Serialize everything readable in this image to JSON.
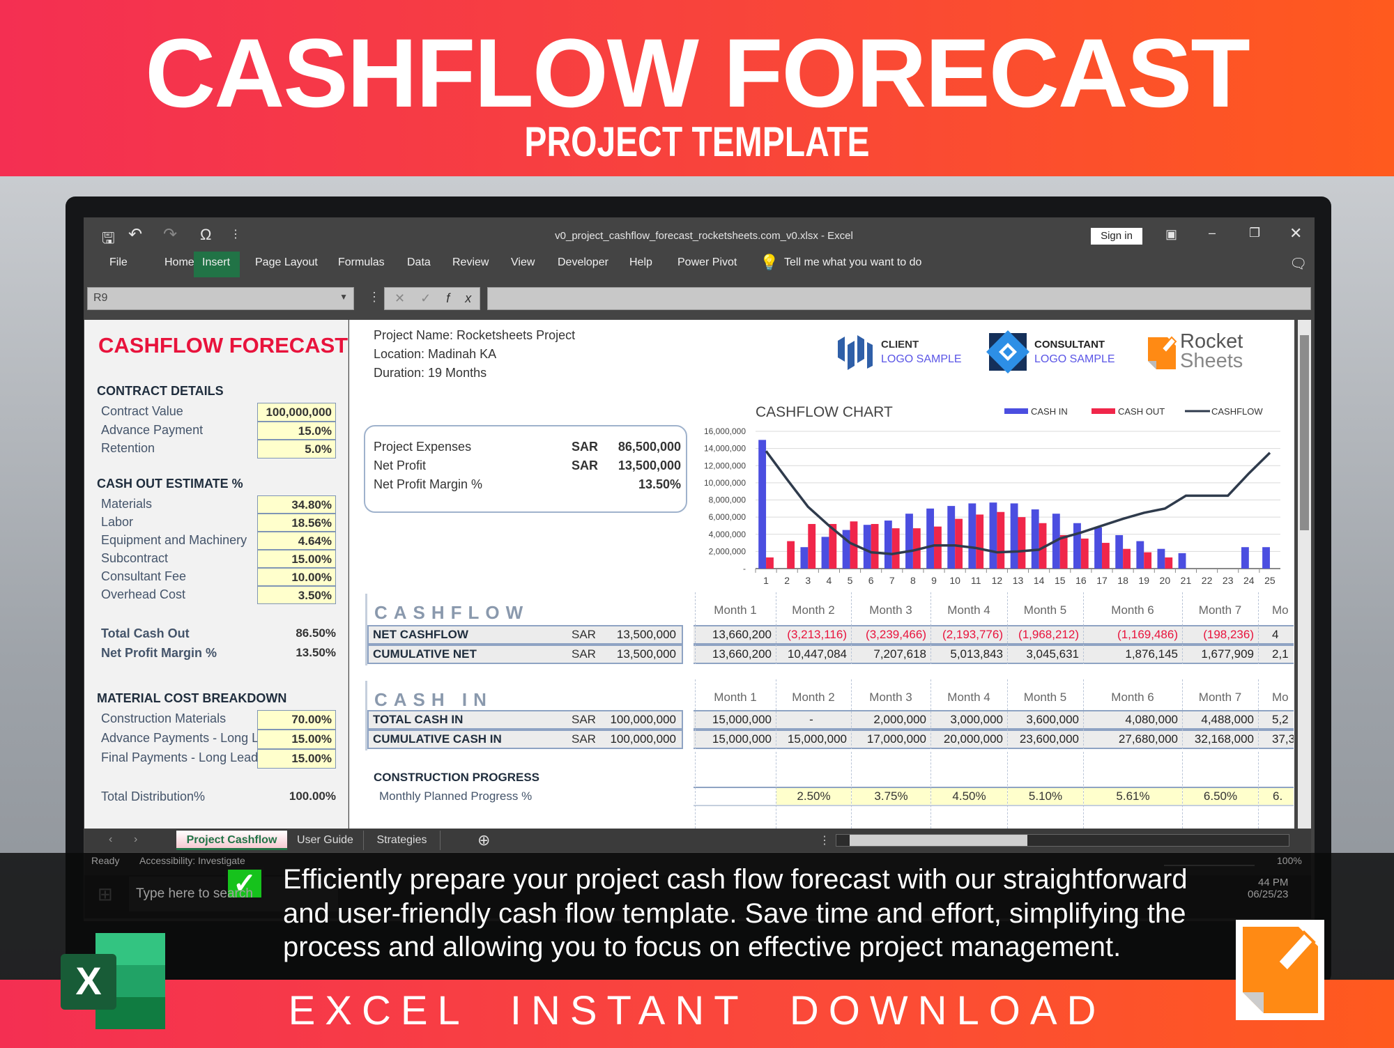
{
  "banner": {
    "title": "CASHFLOW FORECAST",
    "subtitle": "PROJECT TEMPLATE"
  },
  "excel": {
    "file_title": "v0_project_cashflow_forecast_rocketsheets.com_v0.xlsx  -  Excel",
    "sign_in": "Sign in",
    "tabs": [
      "File",
      "Home",
      "Insert",
      "Page Layout",
      "Formulas",
      "Data",
      "Review",
      "View",
      "Developer",
      "Help",
      "Power Pivot"
    ],
    "active_tab": "Insert",
    "tell_me": "Tell me what you want to do",
    "name_box": "R9",
    "formula_value": "",
    "sheet_tabs": [
      "Project Cashflow",
      "User Guide",
      "Strategies"
    ],
    "active_sheet": "Project Cashflow",
    "status": {
      "ready": "Ready",
      "accessibility": "Accessibility: Investigate",
      "zoom": "100%"
    },
    "taskbar": {
      "search_placeholder": "Type here to search",
      "time": "44 PM",
      "date": "06/25/23"
    },
    "colors": {
      "accent_green": "#217346",
      "title_red": "#e8133c"
    }
  },
  "left": {
    "title": "CASHFLOW FORECAST",
    "contract": {
      "heading": "CONTRACT DETAILS",
      "rows": [
        [
          "Contract Value",
          "100,000,000"
        ],
        [
          "Advance Payment",
          "15.0%"
        ],
        [
          "Retention",
          "5.0%"
        ]
      ]
    },
    "cash_out": {
      "heading": "CASH OUT ESTIMATE %",
      "rows": [
        [
          "Materials",
          "34.80%"
        ],
        [
          "Labor",
          "18.56%"
        ],
        [
          "Equipment and Machinery",
          "4.64%"
        ],
        [
          "Subcontract",
          "15.00%"
        ],
        [
          "Consultant Fee",
          "10.00%"
        ],
        [
          "Overhead Cost",
          "3.50%"
        ]
      ]
    },
    "totals": [
      [
        "Total Cash Out",
        "86.50%"
      ],
      [
        "Net Profit Margin %",
        "13.50%"
      ]
    ],
    "material": {
      "heading": "MATERIAL COST BREAKDOWN",
      "rows": [
        [
          "Construction Materials",
          "70.00%"
        ],
        [
          "Advance Payments - Long Lead",
          "15.00%"
        ],
        [
          "Final Payments - Long Lead",
          "15.00%"
        ]
      ]
    },
    "total_distribution": [
      "Total Distribution%",
      "100.00%"
    ]
  },
  "project": {
    "name": "Project Name:  Rocketsheets Project",
    "location": "Location: Madinah KA",
    "duration": "Duration: 19 Months"
  },
  "summary": {
    "rows": [
      [
        "Project Expenses",
        "SAR",
        "86,500,000"
      ],
      [
        "Net Profit",
        "SAR",
        "13,500,000"
      ],
      [
        "Net Profit Margin %",
        "",
        "13.50%"
      ]
    ]
  },
  "logos": {
    "client": [
      "CLIENT",
      "LOGO SAMPLE"
    ],
    "consultant": [
      "CONSULTANT",
      "LOGO SAMPLE"
    ],
    "rocket": [
      "Rocket",
      "Sheets"
    ]
  },
  "cashflow": {
    "heading": "CASHFLOW",
    "rows": [
      [
        "NET CASHFLOW",
        "SAR",
        "13,500,000"
      ],
      [
        "CUMULATIVE NET",
        "SAR",
        "13,500,000"
      ]
    ],
    "months": [
      "Month 1",
      "Month 2",
      "Month 3",
      "Month 4",
      "Month 5",
      "Month 6",
      "Month 7",
      "Mo"
    ],
    "net": [
      "13,660,200",
      "(3,213,116)",
      "(3,239,466)",
      "(2,193,776)",
      "(1,968,212)",
      "(1,169,486)",
      "(198,236)",
      "4"
    ],
    "cumulative": [
      "13,660,200",
      "10,447,084",
      "7,207,618",
      "5,013,843",
      "3,045,631",
      "1,876,145",
      "1,677,909",
      "2,1"
    ]
  },
  "cash_in": {
    "heading": "CASH IN",
    "rows": [
      [
        "TOTAL CASH IN",
        "SAR",
        "100,000,000"
      ],
      [
        "CUMULATIVE CASH IN",
        "SAR",
        "100,000,000"
      ]
    ],
    "months": [
      "Month 1",
      "Month 2",
      "Month 3",
      "Month 4",
      "Month 5",
      "Month 6",
      "Month 7",
      "Mo"
    ],
    "total": [
      "15,000,000",
      "-",
      "2,000,000",
      "3,000,000",
      "3,600,000",
      "4,080,000",
      "4,488,000",
      "5,2"
    ],
    "cumulative": [
      "15,000,000",
      "15,000,000",
      "17,000,000",
      "20,000,000",
      "23,600,000",
      "27,680,000",
      "32,168,000",
      "37,3"
    ]
  },
  "progress": {
    "heading": "CONSTRUCTION PROGRESS",
    "label": "Monthly Planned Progress %",
    "values": [
      "",
      "2.50%",
      "3.75%",
      "4.50%",
      "5.10%",
      "5.61%",
      "6.50%",
      "6."
    ]
  },
  "overlay": {
    "lines": [
      "Efficiently prepare your project cash flow forecast with our straightforward",
      "and user-friendly cash flow template. Save time and effort, simplifying the",
      "process and allowing you to focus on effective project management."
    ]
  },
  "bottom": {
    "text": "EXCEL  INSTANT  DOWNLOAD"
  },
  "chart_data": {
    "type": "bar",
    "title": "CASHFLOW CHART",
    "categories": [
      "1",
      "2",
      "3",
      "4",
      "5",
      "6",
      "7",
      "8",
      "9",
      "10",
      "11",
      "12",
      "13",
      "14",
      "15",
      "16",
      "17",
      "18",
      "19",
      "20",
      "21",
      "22",
      "23",
      "24",
      "25"
    ],
    "yticks": [
      "-",
      "2,000,000",
      "4,000,000",
      "6,000,000",
      "8,000,000",
      "10,000,000",
      "12,000,000",
      "14,000,000",
      "16,000,000"
    ],
    "ylim": [
      0,
      16000000
    ],
    "legend_position": "top-right",
    "grid": true,
    "series": [
      {
        "name": "CASH IN",
        "kind": "bar",
        "color": "#4b4ee0",
        "values": [
          15000000,
          0,
          2500000,
          3700000,
          4500000,
          5100000,
          5600000,
          6400000,
          7000000,
          7300000,
          7600000,
          7700000,
          7600000,
          6900000,
          6400000,
          5300000,
          4800000,
          3900000,
          3200000,
          2300000,
          1800000,
          0,
          0,
          2500000,
          2500000
        ]
      },
      {
        "name": "CASH OUT",
        "kind": "bar",
        "color": "#f0264a",
        "values": [
          1300000,
          3200000,
          5200000,
          5200000,
          5500000,
          5200000,
          4700000,
          4700000,
          4900000,
          5800000,
          6300000,
          6600000,
          6000000,
          5300000,
          3900000,
          3500000,
          3000000,
          2300000,
          1900000,
          1300000,
          0,
          0,
          0,
          0,
          0
        ]
      },
      {
        "name": "CASHFLOW",
        "kind": "line",
        "color": "#2f3b4c",
        "values": [
          13700000,
          10400000,
          7200000,
          5000000,
          3000000,
          1900000,
          1700000,
          2100000,
          2700000,
          2700000,
          2400000,
          1900000,
          2000000,
          2200000,
          3500000,
          4200000,
          5000000,
          5800000,
          6500000,
          7000000,
          8500000,
          8500000,
          8500000,
          11100000,
          13500000
        ]
      }
    ]
  }
}
